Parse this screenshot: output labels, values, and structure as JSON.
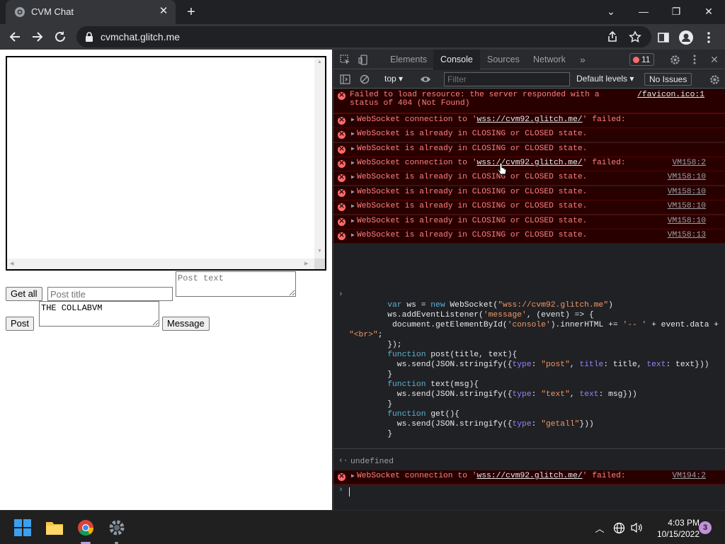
{
  "browser": {
    "tab_title": "CVM Chat",
    "url": "cvmchat.glitch.me"
  },
  "page": {
    "get_all_label": "Get all",
    "post_title_placeholder": "Post title",
    "post_text_placeholder": "Post text",
    "message_value": "THE COLLABVM",
    "post_label": "Post",
    "message_label": "Message"
  },
  "devtools": {
    "tabs": [
      "Elements",
      "Console",
      "Sources",
      "Network"
    ],
    "active_tab": "Console",
    "error_count": "11",
    "context": "top",
    "filter_placeholder": "Filter",
    "levels": "Default levels",
    "issues": "No Issues",
    "logs": [
      {
        "text": "Failed to load resource: the server responded with a",
        "text2": "status of 404 (Not Found)",
        "source": "/favicon.ico:1",
        "expandable": false
      },
      {
        "pre": "WebSocket connection to '",
        "link": "wss://cvm92.glitch.me/",
        "post": "' failed:",
        "source": "",
        "expandable": true
      },
      {
        "text": "WebSocket is already in CLOSING or CLOSED state.",
        "source": "",
        "expandable": true
      },
      {
        "text": "WebSocket is already in CLOSING or CLOSED state.",
        "source": "",
        "expandable": true
      },
      {
        "pre": "WebSocket connection to '",
        "link": "wss://cvm92.glitch.me/",
        "post": "' failed:",
        "source": "VM158:2",
        "expandable": true
      },
      {
        "text": "WebSocket is already in CLOSING or CLOSED state.",
        "source": "VM158:10",
        "expandable": true
      },
      {
        "text": "WebSocket is already in CLOSING or CLOSED state.",
        "source": "VM158:10",
        "expandable": true
      },
      {
        "text": "WebSocket is already in CLOSING or CLOSED state.",
        "source": "VM158:10",
        "expandable": true
      },
      {
        "text": "WebSocket is already in CLOSING or CLOSED state.",
        "source": "VM158:10",
        "expandable": true
      },
      {
        "text": "WebSocket is already in CLOSING or CLOSED state.",
        "source": "VM158:13",
        "expandable": true
      }
    ],
    "result_text": "undefined",
    "last_error": {
      "pre": "WebSocket connection to '",
      "link": "wss://cvm92.glitch.me/",
      "post": "' failed:",
      "source": "VM194:2"
    }
  },
  "taskbar": {
    "time": "4:03 PM",
    "date": "10/15/2022",
    "notifications": "3"
  },
  "colors": {
    "error_bg": "#290000",
    "error_text": "#ff8080",
    "page_bg": "#ffffff",
    "chrome_dark": "#202124"
  }
}
